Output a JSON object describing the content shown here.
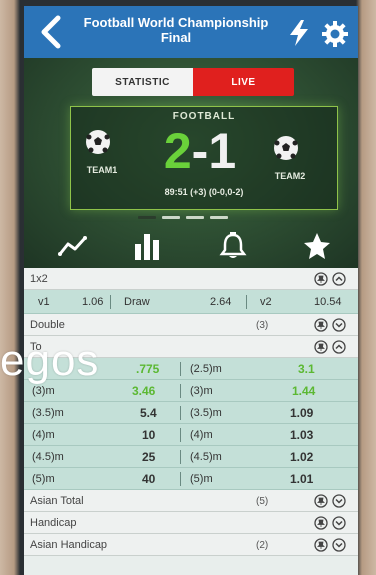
{
  "header": {
    "title_line1": "Football World Championship",
    "title_line2": "Final"
  },
  "tabs": {
    "statistic": "STATISTIC",
    "live": "LIVE"
  },
  "match": {
    "sport": "FOOTBALL",
    "team1": "TEAM1",
    "team2": "TEAM2",
    "home_score": "2",
    "separator": "-",
    "away_score": "1",
    "time_info": "89:51 (+3) (0-0,0-2)"
  },
  "icons": [
    "chart-line-icon",
    "bar-chart-icon",
    "bell-icon",
    "star-icon"
  ],
  "markets": {
    "m1x2": {
      "label": "1x2",
      "v1_label": "v1",
      "v1_odds": "1.06",
      "draw_label": "Draw",
      "draw_odds": "2.64",
      "v2_label": "v2",
      "v2_odds": "10.54"
    },
    "double": {
      "label": "Double",
      "count": "(3)"
    },
    "total": {
      "label": "To",
      "rows": [
        {
          "l_label": "",
          "l_odds": ".775",
          "r_label": "(2.5)m",
          "r_odds": "3.1"
        },
        {
          "l_label": "(3)m",
          "l_odds": "3.46",
          "r_label": "(3)m",
          "r_odds": "1.44"
        },
        {
          "l_label": "(3.5)m",
          "l_odds": "5.4",
          "r_label": "(3.5)m",
          "r_odds": "1.09"
        },
        {
          "l_label": "(4)m",
          "l_odds": "10",
          "r_label": "(4)m",
          "r_odds": "1.03"
        },
        {
          "l_label": "(4.5)m",
          "l_odds": "25",
          "r_label": "(4.5)m",
          "r_odds": "1.02"
        },
        {
          "l_label": "(5)m",
          "l_odds": "40",
          "r_label": "(5)m",
          "r_odds": "1.01"
        }
      ]
    },
    "asian_total": {
      "label": "Asian Total",
      "count": "(5)"
    },
    "handicap": {
      "label": "Handicap"
    },
    "asian_handicap": {
      "label": "Asian Handicap",
      "count": "(2)"
    }
  },
  "overlay_text": "egos",
  "colors": {
    "header_blue": "#2b74b8",
    "live_red": "#e0201e",
    "score_green": "#6ad13a",
    "row_teal": "#c4e0d8",
    "odds_green": "#5bb832"
  }
}
